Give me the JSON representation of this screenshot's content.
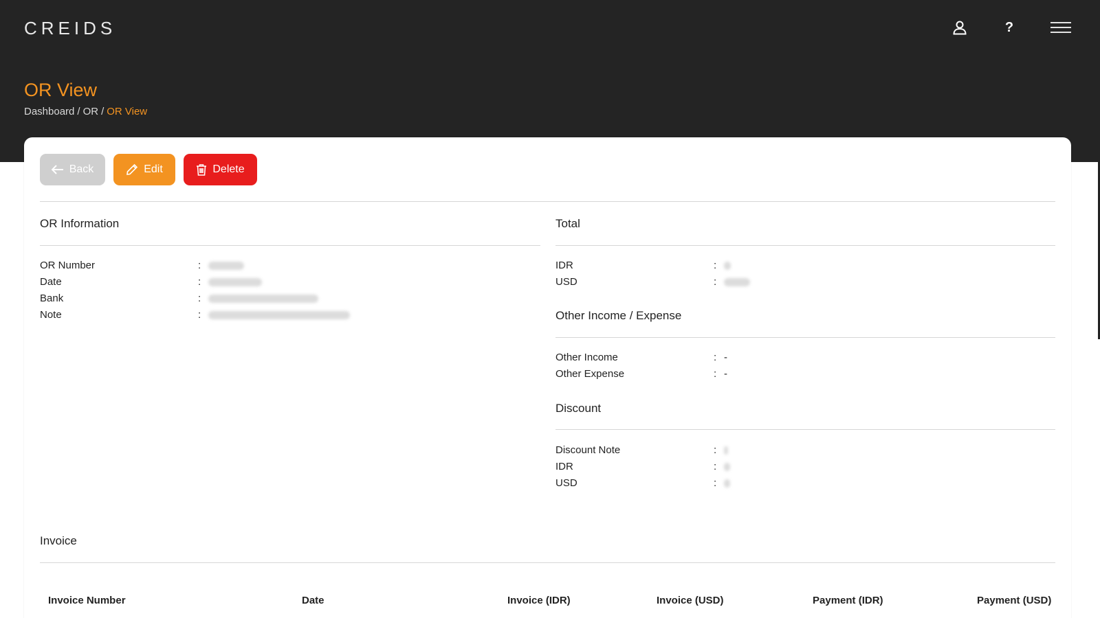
{
  "header": {
    "logo": "CREIDS",
    "icons": [
      "user-icon",
      "help-icon",
      "menu-icon"
    ],
    "help_glyph": "?"
  },
  "page": {
    "title": "OR View",
    "breadcrumb": [
      "Dashboard",
      "OR",
      "OR View"
    ],
    "breadcrumb_separator": "/"
  },
  "actions": {
    "back": "Back",
    "edit": "Edit",
    "delete": "Delete"
  },
  "or_info": {
    "title": "OR Information",
    "rows": [
      {
        "label": "OR Number",
        "value": ""
      },
      {
        "label": "Date",
        "value": ""
      },
      {
        "label": "Bank",
        "value": ""
      },
      {
        "label": "Note",
        "value": ""
      }
    ]
  },
  "total": {
    "title": "Total",
    "rows": [
      {
        "label": "IDR",
        "value": ""
      },
      {
        "label": "USD",
        "value": ""
      }
    ]
  },
  "other": {
    "title": "Other Income / Expense",
    "rows": [
      {
        "label": "Other Income",
        "value": "-"
      },
      {
        "label": "Other Expense",
        "value": "-"
      }
    ]
  },
  "discount": {
    "title": "Discount",
    "rows": [
      {
        "label": "Discount Note",
        "value": ""
      },
      {
        "label": "IDR",
        "value": ""
      },
      {
        "label": "USD",
        "value": ""
      }
    ]
  },
  "invoice": {
    "title": "Invoice",
    "columns": [
      "Invoice Number",
      "Date",
      "Invoice (IDR)",
      "Invoice (USD)",
      "Payment (IDR)",
      "Payment (USD)"
    ]
  },
  "colors": {
    "accent": "#f39321",
    "danger": "#e81d1d",
    "header_bg": "#242424"
  },
  "colon": ":"
}
